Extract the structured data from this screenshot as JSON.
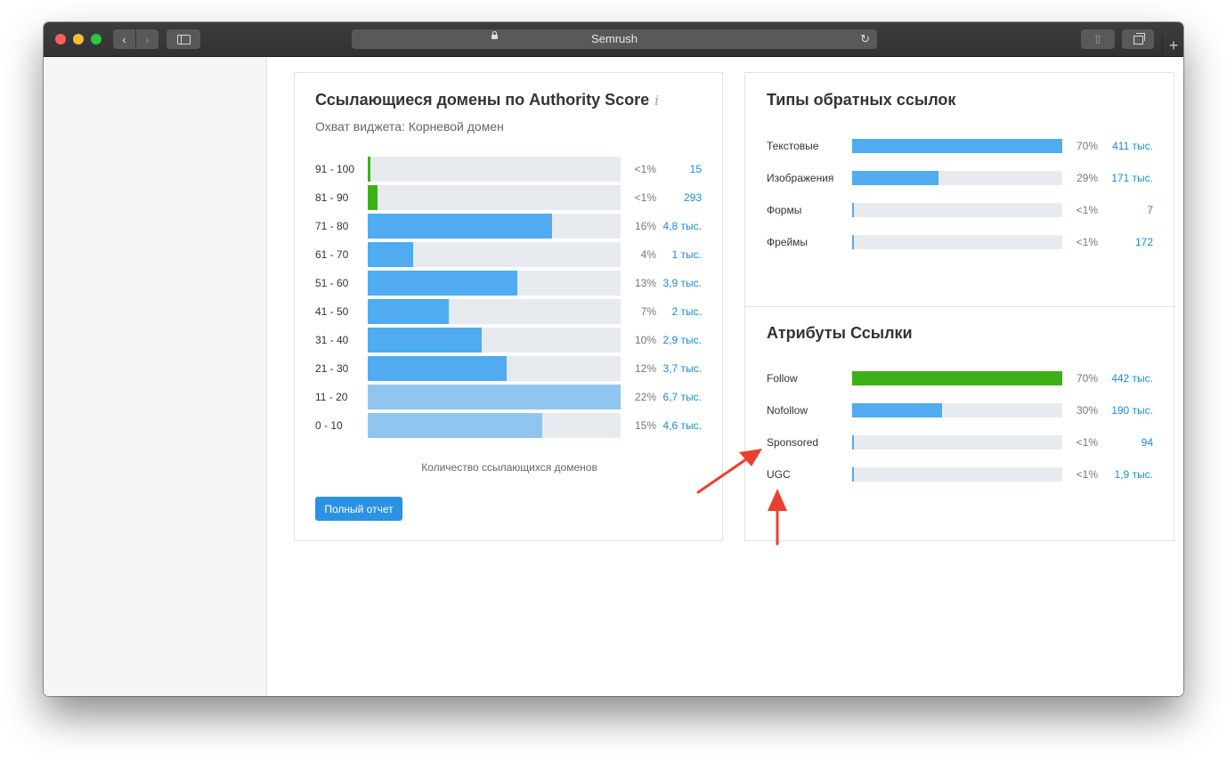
{
  "browser": {
    "address_text": "Semrush"
  },
  "authority_card": {
    "title": "Ссылающиеся домены по Authority Score",
    "info_icon": "i",
    "subtitle": "Охват виджета: Корневой домен",
    "axis_caption": "Количество ссылающихся доменов",
    "button_label": "Полный отчет",
    "rows": [
      {
        "label": "91 - 100",
        "pct": "<1%",
        "value": "15",
        "share": 0.005,
        "color": "#3eb017"
      },
      {
        "label": "81 - 90",
        "pct": "<1%",
        "value": "293",
        "share": 0.04,
        "color": "#3eb017"
      },
      {
        "label": "71 - 80",
        "pct": "16%",
        "value": "4,8 тыс.",
        "share": 0.73,
        "color": "#50abf1"
      },
      {
        "label": "61 - 70",
        "pct": "4%",
        "value": "1 тыс.",
        "share": 0.18,
        "color": "#50abf1"
      },
      {
        "label": "51 - 60",
        "pct": "13%",
        "value": "3,9 тыс.",
        "share": 0.59,
        "color": "#50abf1"
      },
      {
        "label": "41 - 50",
        "pct": "7%",
        "value": "2 тыс.",
        "share": 0.32,
        "color": "#50abf1"
      },
      {
        "label": "31 - 40",
        "pct": "10%",
        "value": "2,9 тыс.",
        "share": 0.45,
        "color": "#50abf1"
      },
      {
        "label": "21 - 30",
        "pct": "12%",
        "value": "3,7 тыс.",
        "share": 0.55,
        "color": "#50abf1"
      },
      {
        "label": "11 - 20",
        "pct": "22%",
        "value": "6,7 тыс.",
        "share": 1.0,
        "color": "#8fc5ee"
      },
      {
        "label": "0 - 10",
        "pct": "15%",
        "value": "4,6 тыс.",
        "share": 0.69,
        "color": "#8fc5ee"
      }
    ]
  },
  "backlink_types": {
    "title": "Типы обратных ссылок",
    "rows": [
      {
        "label": "Текстовые",
        "pct": "70%",
        "value": "411 тыс.",
        "share": 1.0,
        "color": "#50abf1"
      },
      {
        "label": "Изображения",
        "pct": "29%",
        "value": "171 тыс.",
        "share": 0.41,
        "color": "#50abf1"
      },
      {
        "label": "Формы",
        "pct": "<1%",
        "value": "7",
        "share": 0.008,
        "color": "#50abf1"
      },
      {
        "label": "Фреймы",
        "pct": "<1%",
        "value": "172",
        "share": 0.008,
        "color": "#50abf1"
      }
    ]
  },
  "link_attributes": {
    "title": "Атрибуты Ссылки",
    "rows": [
      {
        "label": "Follow",
        "pct": "70%",
        "value": "442 тыс.",
        "share": 1.0,
        "color": "#3eb017"
      },
      {
        "label": "Nofollow",
        "pct": "30%",
        "value": "190 тыс.",
        "share": 0.43,
        "color": "#50abf1"
      },
      {
        "label": "Sponsored",
        "pct": "<1%",
        "value": "94",
        "share": 0.008,
        "color": "#50abf1"
      },
      {
        "label": "UGC",
        "pct": "<1%",
        "value": "1,9 тыс.",
        "share": 0.008,
        "color": "#50abf1"
      }
    ]
  },
  "annotation": {
    "arrow_color": "#e8412f"
  }
}
